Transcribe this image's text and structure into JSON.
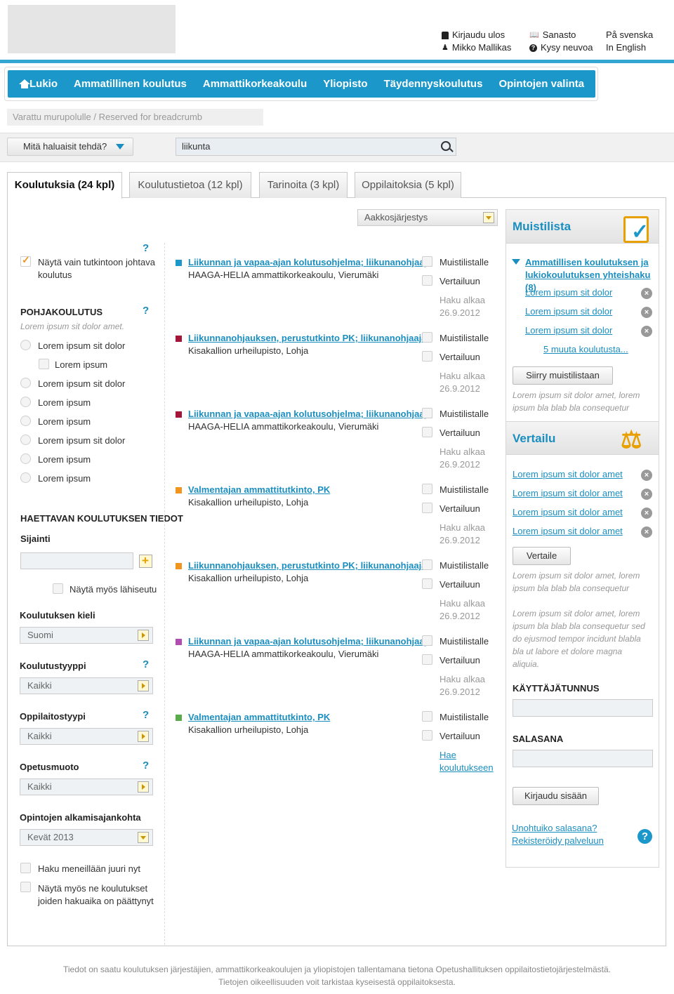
{
  "header": {
    "logout": "Kirjaudu ulos",
    "user": "Mikko Mallikas",
    "glossary": "Sanasto",
    "ask": "Kysy neuvoa",
    "lang_sv": "På svenska",
    "lang_en": "In English"
  },
  "nav": {
    "items": [
      "Lukio",
      "Ammatillinen koulutus",
      "Ammattikorkeakoulu",
      "Yliopisto",
      "Täydennyskoulutus",
      "Opintojen valinta"
    ]
  },
  "breadcrumb": "Varattu murupolulle / Reserved for breadcrumb",
  "search": {
    "what_label": "Mitä haluaisit tehdä?",
    "query": "liikunta"
  },
  "tabs": [
    "Koulutuksia (24 kpl)",
    "Koulutustietoa (12 kpl)",
    "Tarinoita (3 kpl)",
    "Oppilaitoksia (5 kpl)"
  ],
  "sort": "Aakkosjärjestys",
  "filters": {
    "only_degree": "Näytä vain tutkintoon johtava koulutus",
    "base_head": "POHJAKOULUTUS",
    "base_desc": "Lorem ipsum sit dolor amet.",
    "base_options": [
      "Lorem ipsum sit dolor",
      "Lorem ipsum",
      "Lorem ipsum sit dolor",
      "Lorem ipsum",
      "Lorem ipsum",
      "Lorem ipsum sit dolor",
      "Lorem ipsum",
      "Lorem ipsum"
    ],
    "info_head": "HAETTAVAN KOULUTUKSEN TIEDOT",
    "location": "Sijainti",
    "nearby": "Näytä myös lähiseutu",
    "lang_label": "Koulutuksen kieli",
    "lang_value": "Suomi",
    "type_label": "Koulutustyyppi",
    "type_value": "Kaikki",
    "inst_label": "Oppilaitostyypi",
    "inst_value": "Kaikki",
    "mode_label": "Opetusmuoto",
    "mode_value": "Kaikki",
    "start_label": "Opintojen alkamisajankohta",
    "start_value": "Kevät 2013",
    "ongoing": "Haku meneillään juuri nyt",
    "ended": "Näytä myös ne koulutukset joiden hakuaika on päättynyt"
  },
  "results": [
    {
      "title": "Liikunnan ja vapaa-ajan kolutusohjelma; liikunanohjaaja",
      "sub": "HAAGA-HELIA ammattikorkeakoulu, Vierumäki",
      "color": "#1b97c9"
    },
    {
      "title": "Liikunnanohjauksen, perustutkinto PK; liikunanohjaaja",
      "sub": "Kisakallion urheilupisto, Lohja",
      "color": "#a3163a"
    },
    {
      "title": "Liikunnan ja vapaa-ajan kolutusohjelma; liikunanohjaaja",
      "sub": "HAAGA-HELIA ammattikorkeakoulu, Vierumäki",
      "color": "#a3163a"
    },
    {
      "title": "Valmentajan ammattitutkinto, PK",
      "sub": "Kisakallion urheilupisto, Lohja",
      "color": "#f0961e"
    },
    {
      "title": "Liikunnanohjauksen, perustutkinto PK; liikunanohjaaja",
      "sub": "Kisakallion urheilupisto, Lohja",
      "color": "#f0961e"
    },
    {
      "title": "Liikunnan ja vapaa-ajan kolutusohjelma; liikunanohjaaja",
      "sub": "HAAGA-HELIA ammattikorkeakoulu, Vierumäki",
      "color": "#b14cb0"
    },
    {
      "title": "Valmentajan ammattitutkinto, PK",
      "sub": "Kisakallion urheilupisto, Lohja",
      "color": "#5aab4a"
    }
  ],
  "result_actions": {
    "memo": "Muistilistalle",
    "compare": "Vertailuun",
    "haku_alkaa": "Haku alkaa",
    "date": "26.9.2012",
    "apply": "Hae koulutukseen"
  },
  "memo": {
    "title": "Muistilista",
    "group": "Ammatillisen koulutuksen ja lukiokoulutuksen yhteishaku (8)",
    "items": [
      "Lorem ipsum sit dolor",
      "Lorem ipsum sit dolor",
      "Lorem ipsum sit dolor"
    ],
    "more": "5 muuta koulutusta...",
    "button": "Siirry muistilistaan",
    "note": "Lorem ipsum sit dolor amet, lorem ipsum bla blab bla consequetur"
  },
  "compare": {
    "title": "Vertailu",
    "items": [
      "Lorem ipsum sit dolor amet",
      "Lorem ipsum sit dolor amet",
      "Lorem ipsum sit dolor amet",
      "Lorem ipsum sit dolor amet"
    ],
    "button": "Vertaile",
    "note": "Lorem ipsum sit dolor amet, lorem ipsum bla blab bla consequetur",
    "note2": "Lorem ipsum sit dolor amet, lorem ipsum bla blab bla consequetur sed do ejusmod tempor incidunt blabla bla ut labore et dolore magna aliquia."
  },
  "login": {
    "user_label": "KÄYTTÄJÄTUNNUS",
    "pass_label": "SALASANA",
    "button": "Kirjaudu sisään",
    "forgot": "Unohtuiko salasana?",
    "register": "Rekisteröidy palveluun"
  },
  "footer": {
    "line1": "Tiedot on saatu koulutuksen järjestäjien, ammattikorkeakoulujen ja yliopistojen tallentamana tietona Opetushallituksen oppilaitostietojärjestelmästä.",
    "line2": "Tietojen oikeellisuuden voit tarkistaa kyseisestä oppilaitoksesta."
  },
  "colors": {
    "accent": "#1b97c9",
    "topbar": "#33a7d1"
  }
}
